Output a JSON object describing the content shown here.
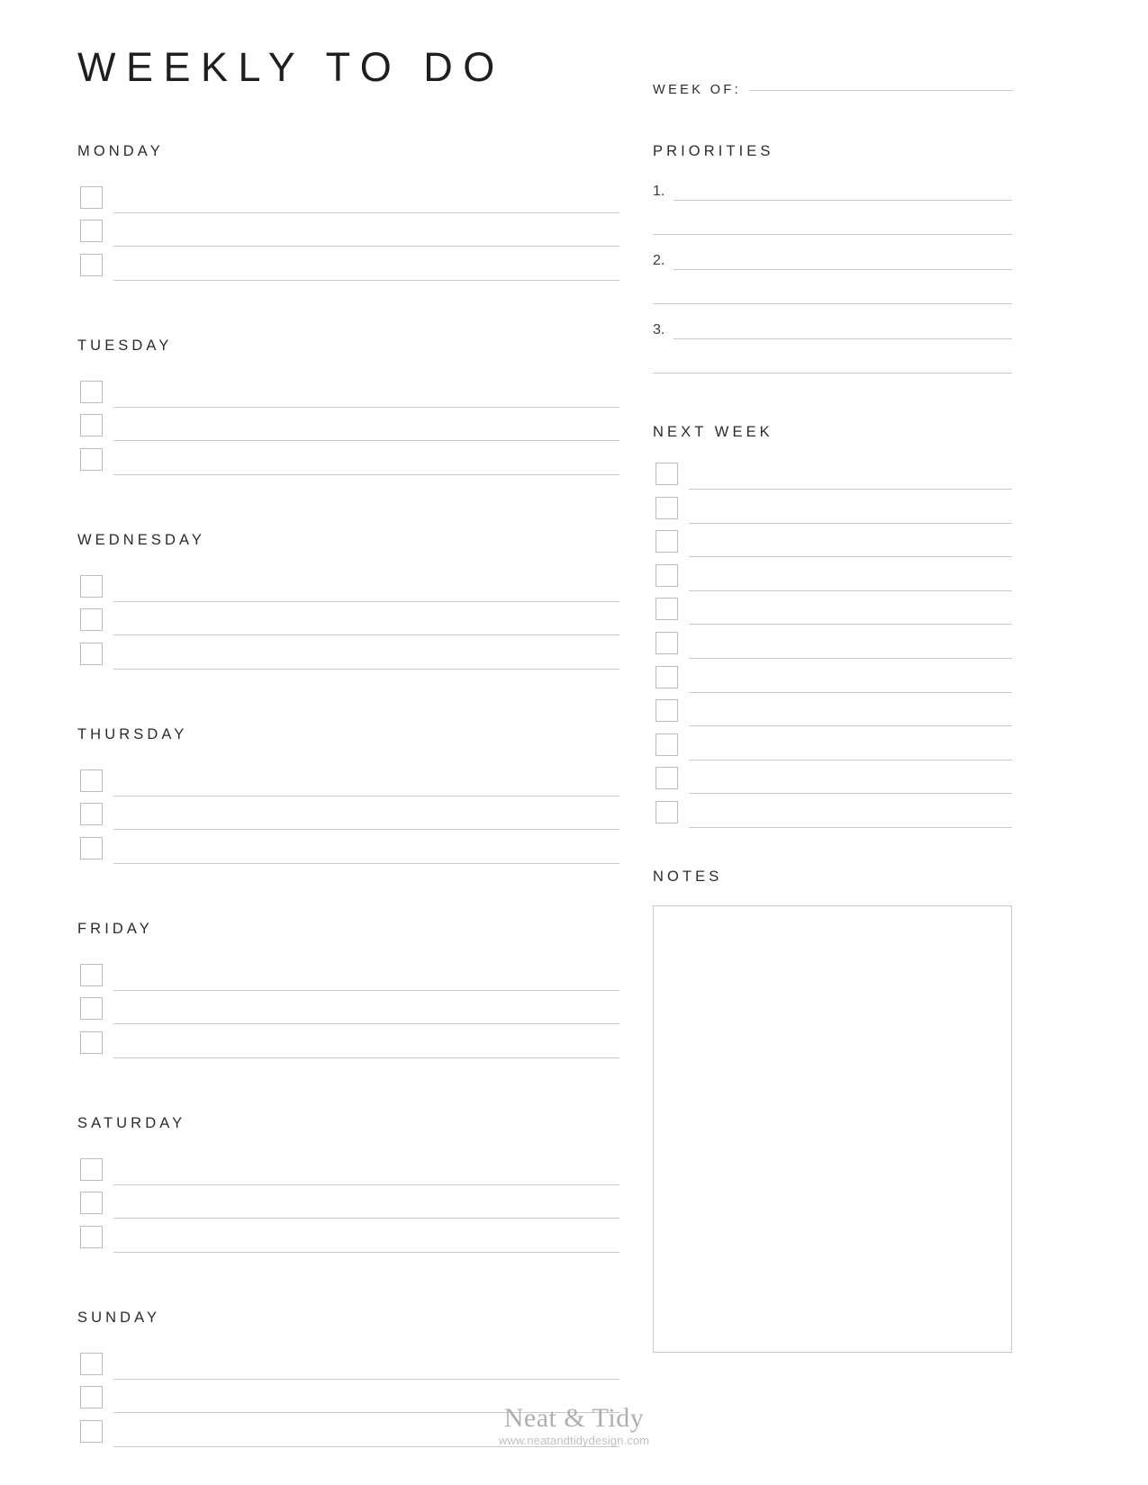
{
  "header": {
    "title": "WEEKLY TO DO",
    "week_of_label": "WEEK OF:"
  },
  "days": [
    {
      "name": "MONDAY",
      "tasks": 3
    },
    {
      "name": "TUESDAY",
      "tasks": 3
    },
    {
      "name": "WEDNESDAY",
      "tasks": 3
    },
    {
      "name": "THURSDAY",
      "tasks": 3
    },
    {
      "name": "FRIDAY",
      "tasks": 3
    },
    {
      "name": "SATURDAY",
      "tasks": 3
    },
    {
      "name": "SUNDAY",
      "tasks": 3
    }
  ],
  "priorities": {
    "heading": "PRIORITIES",
    "rows": [
      {
        "number": "1.",
        "numbered": true
      },
      {
        "number": "",
        "numbered": false
      },
      {
        "number": "2.",
        "numbered": true
      },
      {
        "number": "",
        "numbered": false
      },
      {
        "number": "3.",
        "numbered": true
      },
      {
        "number": "",
        "numbered": false
      }
    ]
  },
  "next_week": {
    "heading": "NEXT WEEK",
    "row_count": 11
  },
  "notes": {
    "heading": "NOTES",
    "content": ""
  },
  "footer": {
    "brand": "Neat & Tidy",
    "url": "www.neatandtidydesign.com"
  },
  "colors": {
    "text": "#2b2b2b",
    "rule": "#c9c9c9",
    "checkbox_border": "#bcbcbc",
    "footer_brand": "#b3aeae",
    "footer_url": "#c3bfbf",
    "background": "#ffffff"
  }
}
